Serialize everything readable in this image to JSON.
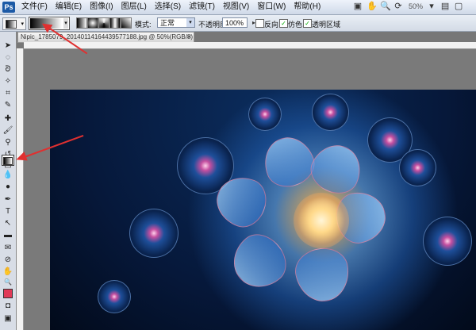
{
  "menubar": {
    "logo": "Ps",
    "items": [
      "文件(F)",
      "编辑(E)",
      "图像(I)",
      "图层(L)",
      "选择(S)",
      "滤镜(T)",
      "视图(V)",
      "窗口(W)",
      "帮助(H)"
    ],
    "zoom": "50%"
  },
  "options": {
    "mode_label": "模式:",
    "mode_value": "正常",
    "opacity_label": "不透明度:",
    "opacity_value": "100%",
    "reverse_label": "反向",
    "reverse_checked": false,
    "dither_label": "仿色",
    "dither_checked": true,
    "transparency_label": "透明区域",
    "transparency_checked": true
  },
  "document": {
    "tab_title": "Nipic_1785079_20140114164439577188.jpg @ 50%(RGB/8)",
    "close": "×"
  },
  "colors": {
    "foreground": "#e03a57",
    "annotation_arrow": "#e03030"
  },
  "icons": {
    "tools": [
      "move",
      "marquee",
      "lasso",
      "magic-wand",
      "crop",
      "slice",
      "healing-brush",
      "brush",
      "clone-stamp",
      "history-brush",
      "eraser",
      "gradient",
      "blur",
      "dodge",
      "pen",
      "type",
      "path-selection",
      "shape",
      "notes",
      "eyedropper",
      "hand",
      "zoom"
    ]
  }
}
